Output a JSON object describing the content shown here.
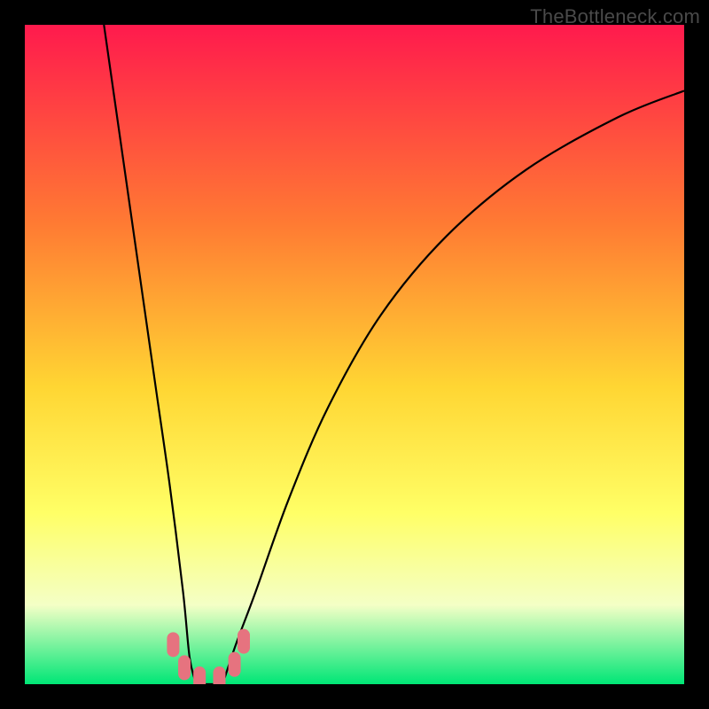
{
  "watermark": "TheBottleneck.com",
  "chart_data": {
    "type": "line",
    "title": "",
    "xlabel": "",
    "ylabel": "",
    "xlim": [
      0,
      100
    ],
    "ylim": [
      0,
      100
    ],
    "background_gradient": {
      "top": "#ff1a4d",
      "upper_mid": "#ff7a33",
      "mid": "#ffd633",
      "lower_mid": "#ffff66",
      "lower": "#f4ffc6",
      "bottom": "#00e676"
    },
    "series": [
      {
        "name": "bottleneck-curve-left",
        "x": [
          12,
          14,
          16,
          18,
          20,
          22,
          24,
          25,
          26
        ],
        "values": [
          100,
          86,
          72,
          58,
          44,
          30,
          14,
          4,
          0
        ]
      },
      {
        "name": "bottleneck-curve-right",
        "x": [
          30,
          32,
          35,
          40,
          46,
          54,
          64,
          76,
          90,
          100
        ],
        "values": [
          0,
          6,
          14,
          28,
          42,
          56,
          68,
          78,
          86,
          90
        ]
      }
    ],
    "floor_band_y": [
      0,
      0
    ],
    "markers": {
      "name": "valley-markers",
      "color": "#e6737f",
      "points": [
        {
          "x": 22.5,
          "y": 6
        },
        {
          "x": 24.2,
          "y": 2.5
        },
        {
          "x": 26.5,
          "y": 0.8
        },
        {
          "x": 29.5,
          "y": 0.8
        },
        {
          "x": 31.8,
          "y": 3
        },
        {
          "x": 33.2,
          "y": 6.5
        }
      ]
    }
  }
}
